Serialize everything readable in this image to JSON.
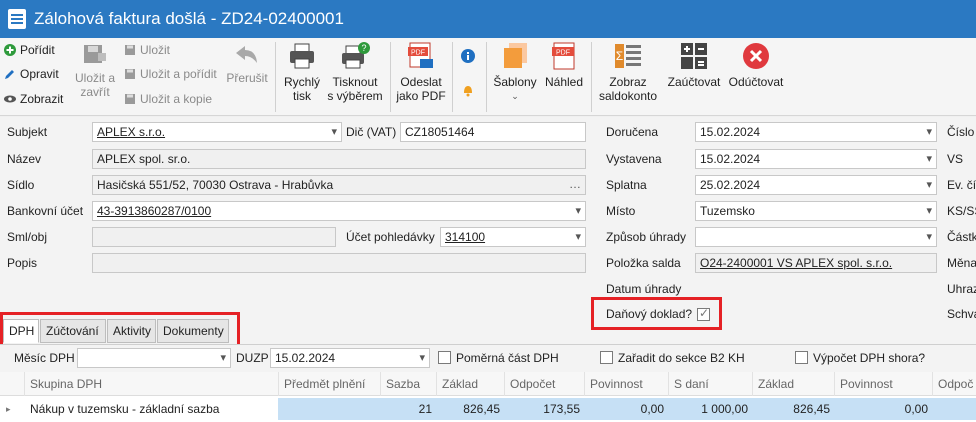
{
  "window": {
    "title": "Zálohová faktura došlá - ZD24-02400001"
  },
  "ribbon": {
    "new": "Pořídit",
    "edit": "Opravit",
    "show": "Zobrazit",
    "save_close": [
      "Uložit a",
      "zavřít"
    ],
    "save": "Uložit",
    "save_new": "Uložit a pořídit",
    "save_copy": "Uložit a kopie",
    "abort": "Přerušit",
    "quick_print": [
      "Rychlý",
      "tisk"
    ],
    "print_selection": [
      "Tisknout",
      "s výběrem"
    ],
    "send_pdf": [
      "Odeslat",
      "jako PDF"
    ],
    "templates": "Šablony",
    "preview": "Náhled",
    "show_balance": [
      "Zobraz",
      "saldokonto"
    ],
    "post": "Zaúčtovat",
    "unpost": "Odúčtovat"
  },
  "form": {
    "subject_label": "Subjekt",
    "subject_value": "APLEX s.r.o.",
    "vat_label": "Dič (VAT)",
    "vat_value": "CZ18051464",
    "name_label": "Název",
    "name_value": "APLEX  spol. sr.o.",
    "seat_label": "Sídlo",
    "seat_value": "Hasičská 551/52, 70030 Ostrava - Hrabůvka",
    "bank_label": "Bankovní účet",
    "bank_value": "43-3913860287/0100",
    "contract_label": "Sml/obj",
    "contract_value": "",
    "receivable_label": "Účet pohledávky",
    "receivable_value": "314100",
    "desc_label": "Popis",
    "desc_value": "",
    "delivered_label": "Doručena",
    "delivered_value": "15.02.2024",
    "issued_label": "Vystavena",
    "issued_value": "15.02.2024",
    "due_label": "Splatna",
    "due_value": "25.02.2024",
    "place_label": "Místo",
    "place_value": "Tuzemsko",
    "payment_label": "Způsob úhrady",
    "payment_value": "",
    "ledger_label": "Položka salda",
    "ledger_value": "O24-2400001 VS APLEX  spol. s.r.o.",
    "paydate_label": "Datum úhrady",
    "taxdoc_label": "Daňový doklad?",
    "right_labels": [
      "Číslo",
      "VS",
      "Ev. čí",
      "KS/SS",
      "Částk",
      "Měna",
      "Uhraz",
      "Schva"
    ]
  },
  "tabs": [
    "DPH",
    "Zúčtování",
    "Aktivity",
    "Dokumenty"
  ],
  "dph": {
    "month_label": "Měsíc DPH",
    "duzp_label": "DUZP",
    "duzp_value": "15.02.2024",
    "proportional_label": "Poměrná část DPH",
    "b2_label": "Zařadit do sekce B2 KH",
    "calc_label": "Výpočet DPH shora?"
  },
  "grid": {
    "headers": [
      "Skupina DPH",
      "Předmět plnění",
      "Sazba",
      "Základ",
      "Odpočet",
      "Povinnost",
      "S daní",
      "Základ",
      "Povinnost",
      "Odpoč"
    ],
    "row": [
      "Nákup v tuzemsku - základní sazba",
      "",
      "21",
      "826,45",
      "173,55",
      "0,00",
      "1 000,00",
      "826,45",
      "0,00",
      ""
    ]
  },
  "colors": {
    "title_bar": "#2b79c2",
    "highlight": "#e52125",
    "selection": "#c6e0f5"
  }
}
